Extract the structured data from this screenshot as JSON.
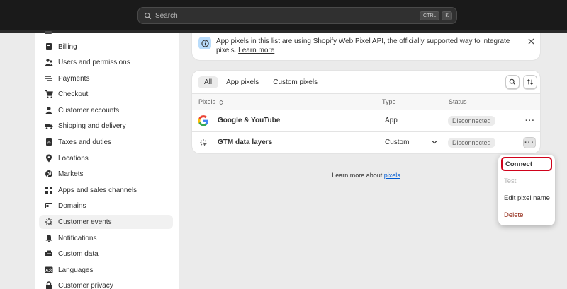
{
  "topbar": {
    "search_placeholder": "Search",
    "shortcut_keys": [
      "CTRL",
      "K"
    ]
  },
  "sidebar": {
    "items": [
      {
        "label": "Billing",
        "icon": "billing-icon"
      },
      {
        "label": "Users and permissions",
        "icon": "users-icon"
      },
      {
        "label": "Payments",
        "icon": "payments-icon"
      },
      {
        "label": "Checkout",
        "icon": "cart-icon"
      },
      {
        "label": "Customer accounts",
        "icon": "person-icon"
      },
      {
        "label": "Shipping and delivery",
        "icon": "truck-icon"
      },
      {
        "label": "Taxes and duties",
        "icon": "tax-icon"
      },
      {
        "label": "Locations",
        "icon": "location-icon"
      },
      {
        "label": "Markets",
        "icon": "globe-icon"
      },
      {
        "label": "Apps and sales channels",
        "icon": "apps-icon"
      },
      {
        "label": "Domains",
        "icon": "domain-icon"
      },
      {
        "label": "Customer events",
        "icon": "events-icon",
        "active": true
      },
      {
        "label": "Notifications",
        "icon": "bell-icon"
      },
      {
        "label": "Custom data",
        "icon": "database-icon"
      },
      {
        "label": "Languages",
        "icon": "language-icon"
      },
      {
        "label": "Customer privacy",
        "icon": "lock-icon"
      }
    ]
  },
  "banner": {
    "text": "App pixels in this list are using Shopify Web Pixel API, the officially supported way to integrate pixels.",
    "link": "Learn more"
  },
  "card": {
    "tabs": [
      "All",
      "App pixels",
      "Custom pixels"
    ],
    "columns": {
      "pixels": "Pixels",
      "type": "Type",
      "status": "Status"
    },
    "rows": [
      {
        "name": "Google & YouTube",
        "type": "App",
        "status": "Disconnected",
        "more": "···"
      },
      {
        "name": "GTM data layers",
        "type": "Custom",
        "status": "Disconnected",
        "more": "···"
      }
    ]
  },
  "footer": {
    "prefix": "Learn more about",
    "link": "pixels"
  },
  "popover": {
    "items": [
      "Connect",
      "Test",
      "Edit pixel name",
      "Delete"
    ]
  },
  "colors": {
    "topbar": "#1a1a1a",
    "highlight": "#d0021b",
    "link": "#005bd3",
    "delete": "#8e1f0b"
  }
}
